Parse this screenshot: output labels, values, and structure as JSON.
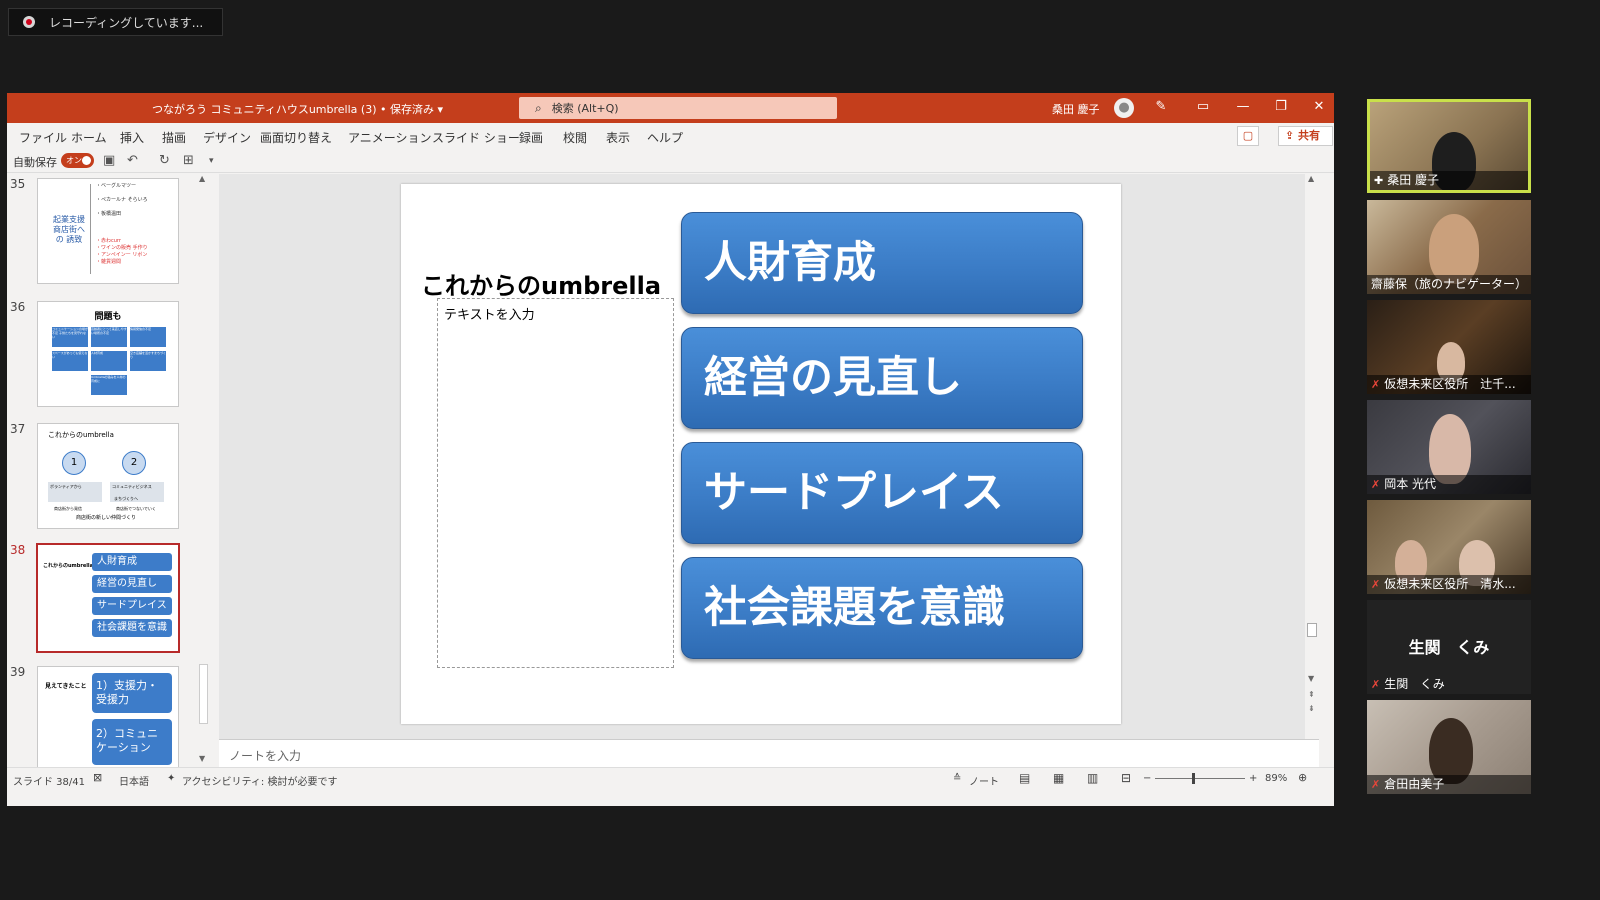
{
  "recording": {
    "text": "レコーディングしています..."
  },
  "titlebar": {
    "doc_title": "つながろう コミュニティハウスumbrella (3) • 保存済み ▾",
    "search_placeholder": "検索 (Alt+Q)",
    "user_name": "桑田 慶子"
  },
  "menu": [
    "ファイル",
    "ホーム",
    "挿入",
    "描画",
    "デザイン",
    "画面切り替え",
    "アニメーション",
    "スライド ショー",
    "録画",
    "校閲",
    "表示",
    "ヘルプ"
  ],
  "share_label": "共有",
  "qat": {
    "autosave_label": "自動保存",
    "autosave_state": "オン"
  },
  "thumbnails": [
    {
      "num": "35",
      "lines": [
        "・ベーグルマツー",
        "・ペカールナ そらいろ",
        "・板橋温田",
        "起業支援 商店街への 誘致",
        "・赤わcurr",
        "・ワインの販売 手作り",
        "・アンペインー リボン",
        "・雑貨週間"
      ]
    },
    {
      "num": "36",
      "title": "問題も",
      "cells": [
        "コミュニケーションの場が不足 子供たちを見守れない",
        "高齢者にとって来店しやすい場所の不足",
        "情報発信の不足",
        "スペースがあっても使えない",
        "人材育成",
        "空き店舗を活かすまちづくり",
        "Umbrellaの強みを人材の育成に"
      ]
    },
    {
      "num": "37",
      "title": "これからのumbrella",
      "circles": [
        "1",
        "2"
      ],
      "lines": [
        "ボランティアから",
        "コミュニティビジネス",
        "まちづくりへ",
        "商店街から発信",
        "商店街でつないでいく",
        "商店街の新しい仲間づくり"
      ]
    },
    {
      "num": "38",
      "title": "これからのumbrella",
      "buttons": [
        "人財育成",
        "経営の見直し",
        "サードプレイス",
        "社会課題を意識"
      ]
    },
    {
      "num": "39",
      "title": "見えてきたこと",
      "buttons": [
        "1）支援力・受援力",
        "2）コミュニケーション"
      ]
    }
  ],
  "slide": {
    "title": "これからのumbrella",
    "placeholder": "テキストを入力",
    "buttons": [
      "人財育成",
      "経営の見直し",
      "サードプレイス",
      "社会課題を意識"
    ]
  },
  "notes_placeholder": "ノートを入力",
  "status": {
    "slide_count": "スライド 38/41",
    "language": "日本語",
    "accessibility": "アクセシビリティ: 検討が必要です",
    "notes_label": "ノート",
    "zoom": "89%"
  },
  "participants": [
    {
      "name": "桑田 慶子",
      "muted": false,
      "active": true
    },
    {
      "name": "齋藤保（旅のナビゲーター）",
      "muted": false,
      "active": false
    },
    {
      "name": "仮想未来区役所　辻千...",
      "muted": true,
      "active": false
    },
    {
      "name": "岡本 光代",
      "muted": true,
      "active": false
    },
    {
      "name": "仮想未来区役所　清水...",
      "muted": true,
      "active": false
    },
    {
      "name": "生関　くみ",
      "muted": true,
      "active": false,
      "no_video": true
    },
    {
      "name": "倉田由美子",
      "muted": true,
      "active": false
    }
  ]
}
